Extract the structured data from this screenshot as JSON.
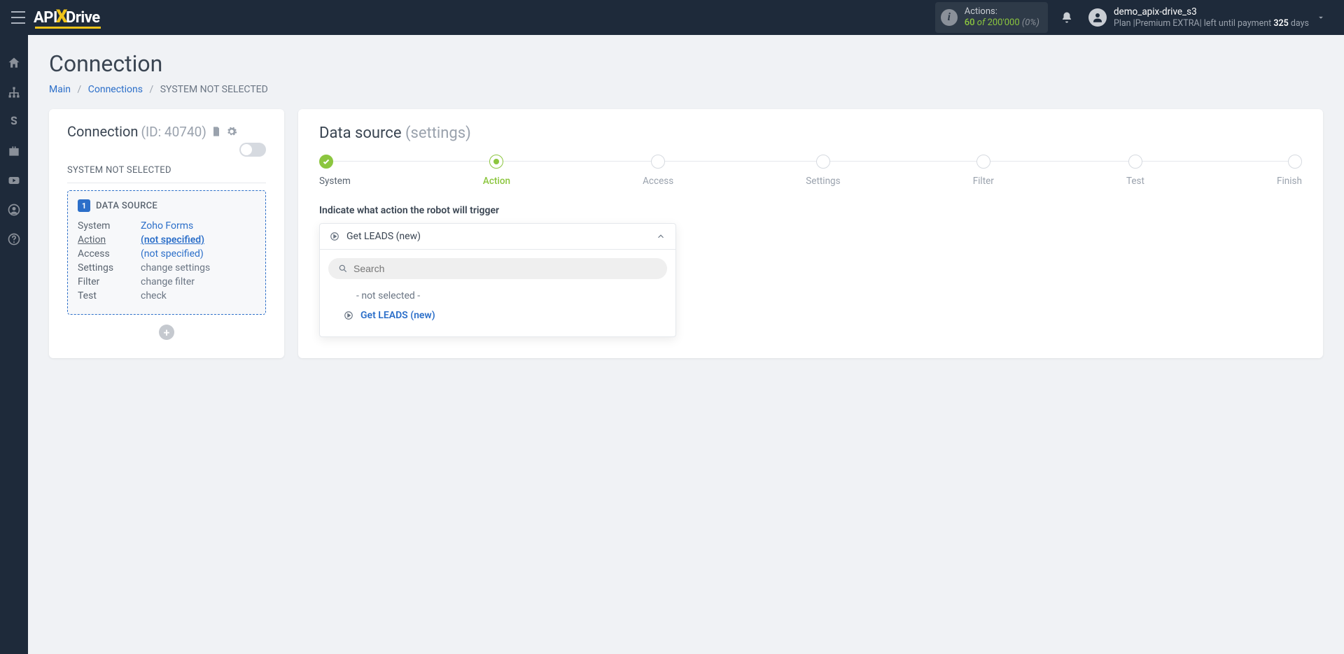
{
  "logo": {
    "part1": "API",
    "part2": "X",
    "part3": "Drive"
  },
  "header": {
    "actions_label": "Actions:",
    "actions_current": "60",
    "actions_of": "of",
    "actions_total": "200'000",
    "actions_pct": "(0%)",
    "username": "demo_apix-drive_s3",
    "plan_prefix": "Plan  |",
    "plan_name": "Premium EXTRA",
    "plan_suffix1": "|  left until payment ",
    "plan_days": "325",
    "plan_suffix2": " days"
  },
  "page": {
    "title": "Connection",
    "breadcrumb": {
      "main": "Main",
      "connections": "Connections",
      "current": "SYSTEM NOT SELECTED"
    }
  },
  "leftcard": {
    "title": "Connection",
    "id": "(ID: 40740)",
    "subtitle": "SYSTEM NOT SELECTED",
    "ds_badge": "1",
    "ds_title": "DATA SOURCE",
    "rows": {
      "system": {
        "k": "System",
        "v": "Zoho Forms",
        "link": true,
        "bold": false
      },
      "action": {
        "k": "Action",
        "v": "(not specified)",
        "link": true,
        "bold": true,
        "kunder": true
      },
      "access": {
        "k": "Access",
        "v": "(not specified)",
        "link": true,
        "bold": false
      },
      "settings": {
        "k": "Settings",
        "v": "change settings",
        "link": false
      },
      "filter": {
        "k": "Filter",
        "v": "change filter",
        "link": false
      },
      "test": {
        "k": "Test",
        "v": "check",
        "link": false
      }
    }
  },
  "rightcard": {
    "title_main": "Data source",
    "title_sub": "(settings)",
    "steps": [
      "System",
      "Action",
      "Access",
      "Settings",
      "Filter",
      "Test",
      "Finish"
    ],
    "field_label": "Indicate what action the robot will trigger",
    "selected": "Get LEADS (new)",
    "search_placeholder": "Search",
    "opt_notselected": "- not selected -",
    "opt_getleads": "Get LEADS (new)"
  }
}
